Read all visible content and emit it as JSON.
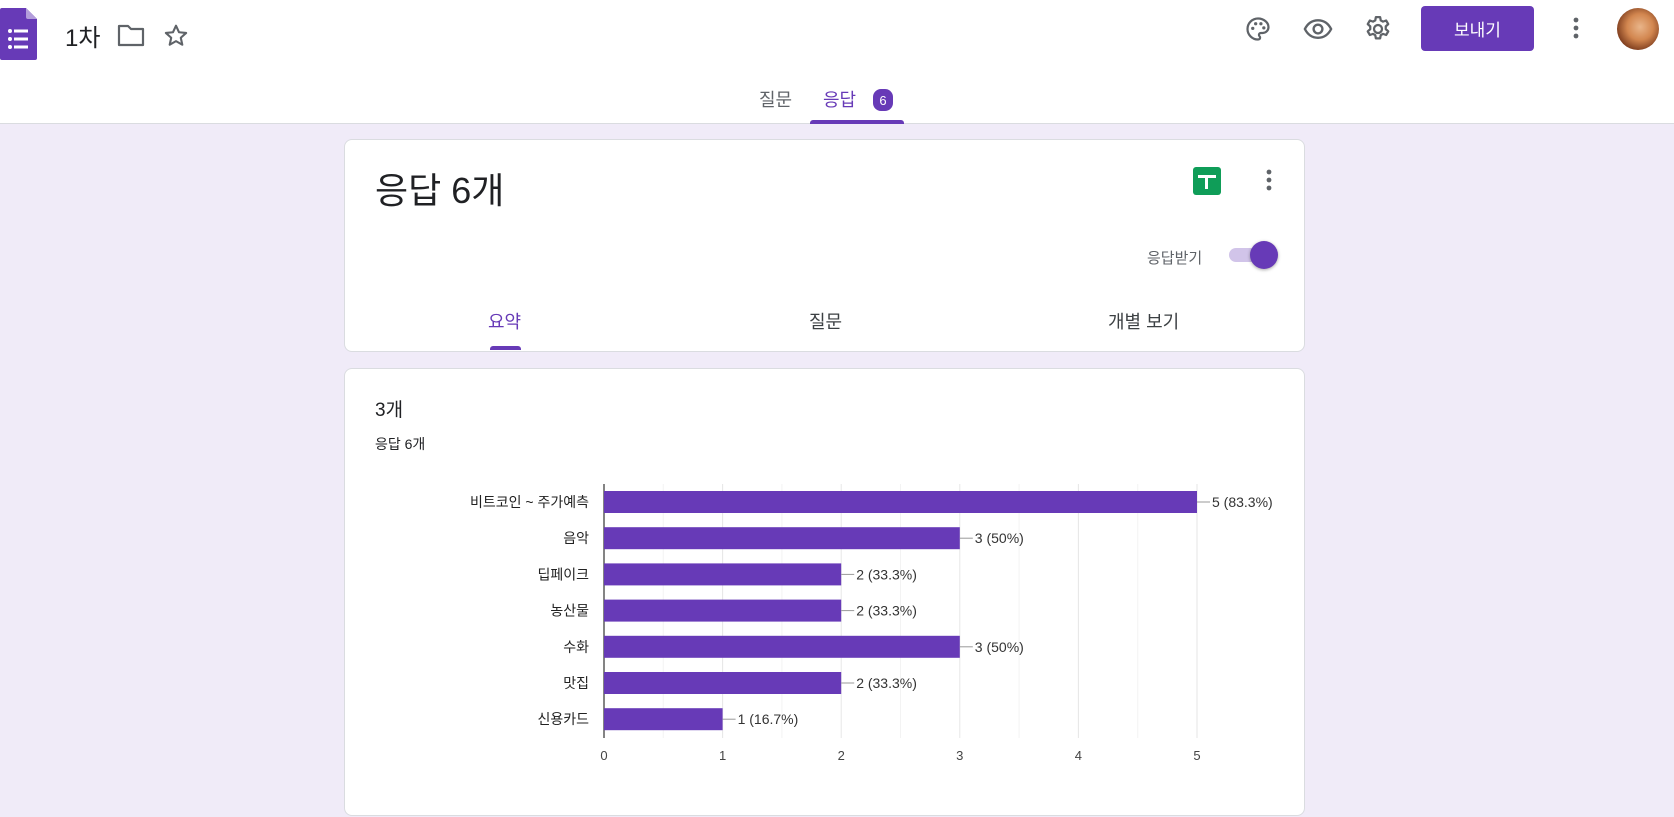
{
  "header": {
    "doc_title": "1차",
    "send_label": "보내기",
    "tabs": [
      {
        "label": "질문"
      },
      {
        "label": "응답",
        "badge": "6"
      }
    ]
  },
  "summary": {
    "title": "응답 6개",
    "accepting_label": "응답받기",
    "accepting_responses": true,
    "sub_tabs": [
      {
        "label": "요약"
      },
      {
        "label": "질문"
      },
      {
        "label": "개별 보기"
      }
    ]
  },
  "question": {
    "title": "3개",
    "response_count": "응답 6개"
  },
  "colors": {
    "accent": "#673ab7",
    "background": "#f0ebf8",
    "sheets_green": "#0f9d58"
  },
  "icons": [
    "forms-logo-icon",
    "folder-icon",
    "star-icon",
    "palette-icon",
    "eye-icon",
    "gear-icon",
    "more-vert-icon",
    "sheets-icon"
  ],
  "chart_data": {
    "type": "bar",
    "orientation": "horizontal",
    "categories": [
      "비트코인 ~ 주가예측",
      "음악",
      "딥페이크",
      "농산물",
      "수화",
      "맛집",
      "신용카드"
    ],
    "values": [
      5,
      3,
      2,
      2,
      3,
      2,
      1
    ],
    "value_labels": [
      "5 (83.3%)",
      "3 (50%)",
      "2 (33.3%)",
      "2 (33.3%)",
      "3 (50%)",
      "2 (33.3%)",
      "1 (16.7%)"
    ],
    "xlim": [
      0,
      5
    ],
    "x_ticks": [
      0,
      1,
      2,
      3,
      4,
      5
    ],
    "grid": true,
    "bar_color": "#673ab7"
  }
}
